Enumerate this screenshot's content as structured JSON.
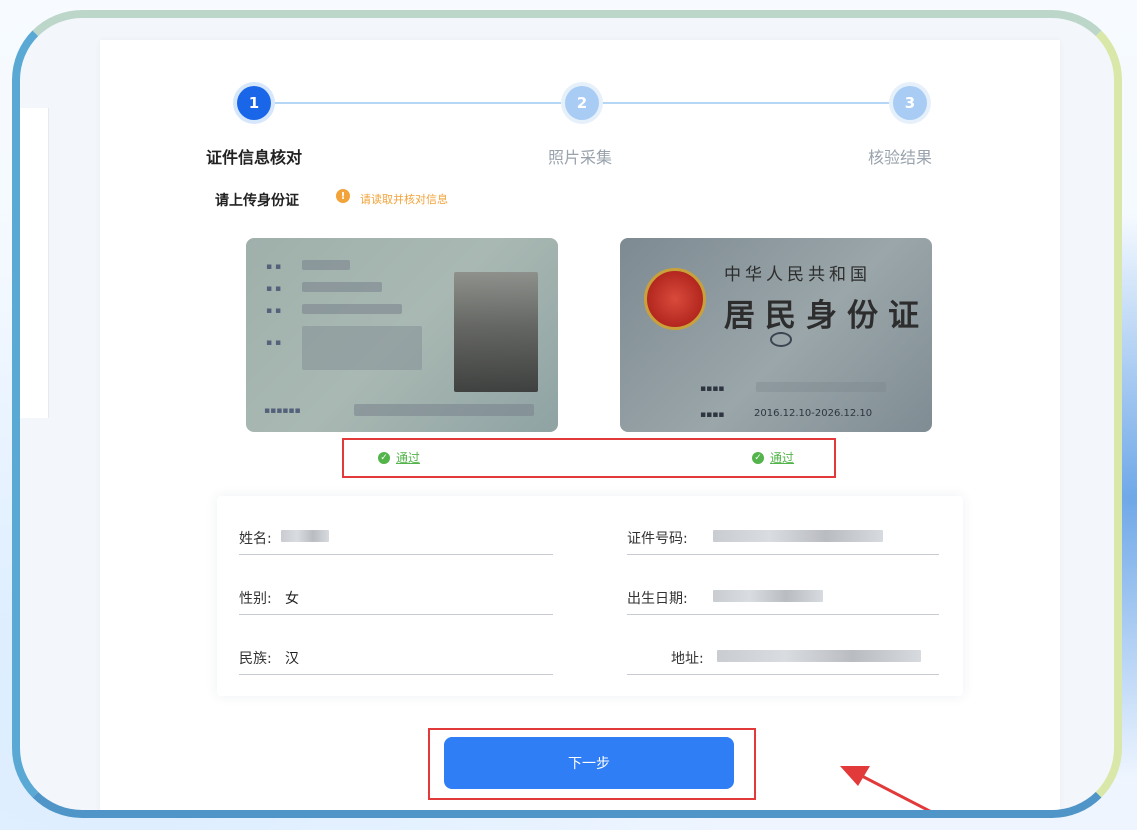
{
  "steps": [
    {
      "number": "1",
      "label": "证件信息核对"
    },
    {
      "number": "2",
      "label": "照片采集"
    },
    {
      "number": "3",
      "label": "核验结果"
    }
  ],
  "upload": {
    "title": "请上传身份证",
    "hint": "请读取并核对信息"
  },
  "card_back": {
    "line1": "中华人民共和国",
    "line2": "居民身份证",
    "validity": "2016.12.10-2026.12.10"
  },
  "verification": {
    "front_status": "通过",
    "back_status": "通过"
  },
  "form": {
    "name_label": "姓名:",
    "gender_label": "性别:",
    "gender_value": "女",
    "ethnicity_label": "民族:",
    "ethnicity_value": "汉",
    "id_number_label": "证件号码:",
    "birth_date_label": "出生日期:",
    "address_label": "地址:"
  },
  "actions": {
    "next_label": "下一步"
  },
  "colors": {
    "primary": "#2f7ef5",
    "step_active": "#1a66e8",
    "success": "#52b44a",
    "warning": "#f2a33a",
    "annotation": "#e23a3a"
  }
}
